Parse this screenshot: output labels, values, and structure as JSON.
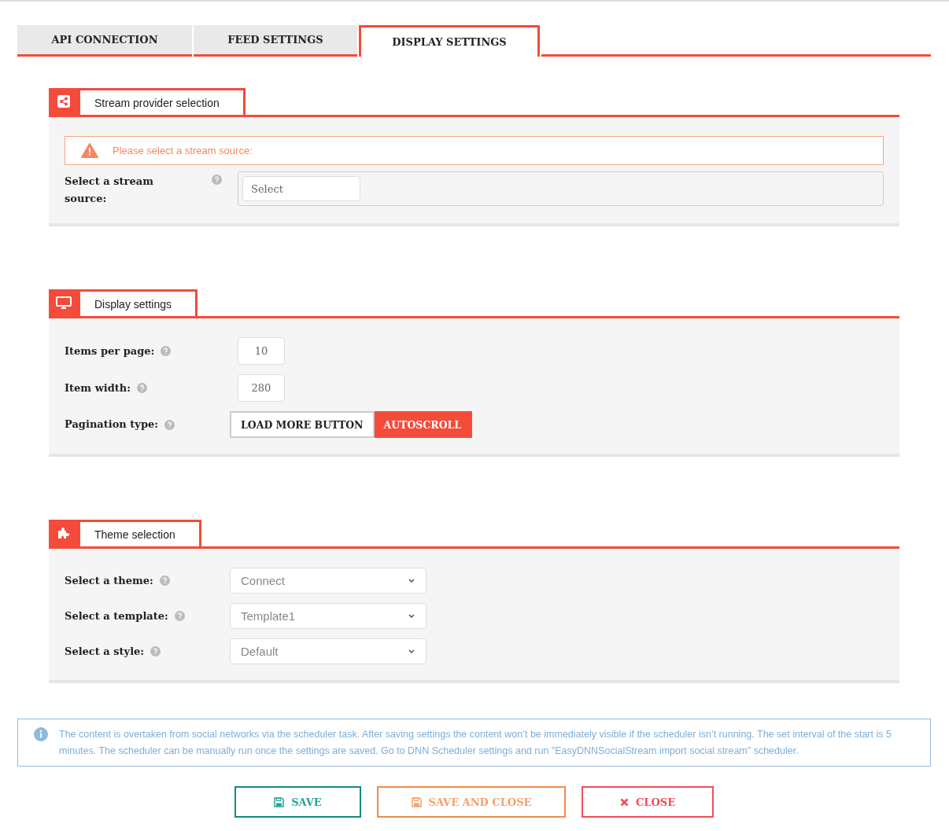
{
  "tabs": [
    {
      "label": "API CONNECTION",
      "selected": false
    },
    {
      "label": "FEED SETTINGS",
      "selected": false
    },
    {
      "label": "DISPLAY SETTINGS",
      "selected": true
    }
  ],
  "sections": [
    {
      "title": "Stream provider selection",
      "rows": [
        {
          "kind": "alert",
          "text": "Please select a stream source:"
        },
        {
          "kind": "stream",
          "label": "Select a stream source:",
          "placeholder": "Select"
        }
      ]
    },
    {
      "title": "Display settings",
      "rows": [
        {
          "kind": "number",
          "label": "Items per page:",
          "value": "10"
        },
        {
          "kind": "number",
          "label": "Item width:",
          "value": "280"
        },
        {
          "kind": "toggle",
          "label": "Pagination type:",
          "options": [
            {
              "label": "LOAD MORE BUTTON",
              "selected": false
            },
            {
              "label": "AUTOSCROLL",
              "selected": true
            }
          ]
        }
      ]
    },
    {
      "title": "Theme selection",
      "rows": [
        {
          "kind": "dropdown",
          "label": "Select a theme:",
          "value": "Connect"
        },
        {
          "kind": "dropdown",
          "label": "Select a template:",
          "value": "Template1"
        },
        {
          "kind": "dropdown",
          "label": "Select a style:",
          "value": "Default"
        }
      ]
    }
  ],
  "info": "The content is overtaken from social networks via the scheduler task. After saving settings the content won’t be immediately visible if the scheduler isn’t running. The set interval of the start is 5 minutes. The scheduler can be manually run once the settings are saved. Go to DNN Scheduler settings and run \"EasyDNNSocialStream import social stream\" scheduler.",
  "buttons": [
    {
      "kind": "save",
      "label": "SAVE"
    },
    {
      "kind": "save_close",
      "label": "SAVE AND CLOSE"
    },
    {
      "kind": "close",
      "label": "CLOSE"
    }
  ]
}
